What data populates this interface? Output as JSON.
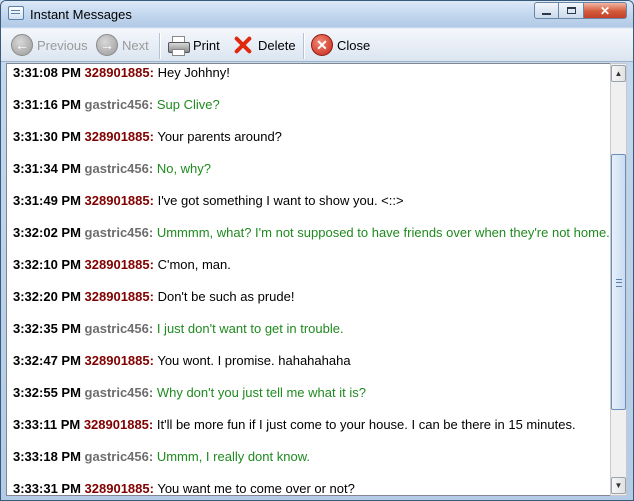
{
  "window": {
    "title": "Instant Messages"
  },
  "toolbar": {
    "previous_label": "Previous",
    "next_label": "Next",
    "print_label": "Print",
    "delete_label": "Delete",
    "close_label": "Close"
  },
  "colors": {
    "user1": "#800000",
    "user2": "#6d6d6d",
    "text1": "#000000",
    "text2": "#1f8a1f"
  },
  "messages": [
    {
      "time": "3:31:08 PM",
      "user": "328901885:",
      "text": "Hey Johhny!"
    },
    {
      "time": "3:31:16 PM",
      "user": "gastric456:",
      "text": "Sup Clive?"
    },
    {
      "time": "3:31:30 PM",
      "user": "328901885:",
      "text": "Your parents around?"
    },
    {
      "time": "3:31:34 PM",
      "user": "gastric456:",
      "text": "No, why?"
    },
    {
      "time": "3:31:49 PM",
      "user": "328901885:",
      "text": "I've got something I want to show you. <::>"
    },
    {
      "time": "3:32:02 PM",
      "user": "gastric456:",
      "text": "Ummmm, what? I'm not supposed to have friends over when they're not home."
    },
    {
      "time": "3:32:10 PM",
      "user": "328901885:",
      "text": "C'mon, man."
    },
    {
      "time": "3:32:20 PM",
      "user": "328901885:",
      "text": "Don't be such as prude!"
    },
    {
      "time": "3:32:35 PM",
      "user": "gastric456:",
      "text": "I just don't want to get in trouble."
    },
    {
      "time": "3:32:47 PM",
      "user": "328901885:",
      "text": "You wont. I promise. hahahahaha"
    },
    {
      "time": "3:32:55 PM",
      "user": "gastric456:",
      "text": "Why don't you just tell me what it is?"
    },
    {
      "time": "3:33:11 PM",
      "user": "328901885:",
      "text": "It'll be more fun if I just come to your house. I can be there in 15 minutes."
    },
    {
      "time": "3:33:18 PM",
      "user": "gastric456:",
      "text": "Ummm, I really dont know."
    },
    {
      "time": "3:33:31 PM",
      "user": "328901885:",
      "text": "You want me to come over or not?"
    }
  ]
}
